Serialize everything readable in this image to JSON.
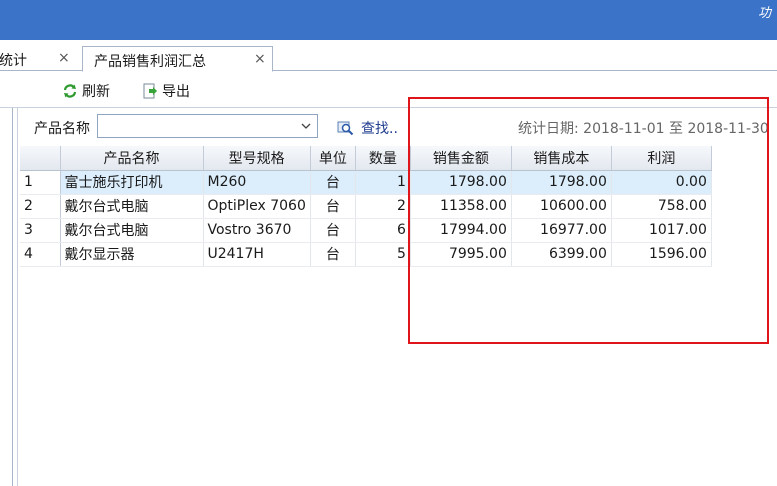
{
  "titlebar": {
    "corner_text": "功"
  },
  "tabs": [
    {
      "label": "统计",
      "active": false
    },
    {
      "label": "产品销售利润汇总",
      "active": true
    }
  ],
  "tab_close_glyph": "×",
  "toolbar": {
    "refresh_label": "刷新",
    "export_label": "导出"
  },
  "filter": {
    "product_label": "产品名称",
    "product_value": "",
    "find_label": "查找..",
    "date_label": "统计日期:",
    "date_from": "2018-11-01",
    "date_sep": "至",
    "date_to": "2018-11-30"
  },
  "table": {
    "columns": [
      "",
      "产品名称",
      "型号规格",
      "单位",
      "数量",
      "销售金额",
      "销售成本",
      "利润"
    ],
    "rows": [
      [
        "1",
        "富士施乐打印机",
        "M260",
        "台",
        "1",
        "1798.00",
        "1798.00",
        "0.00"
      ],
      [
        "2",
        "戴尔台式电脑",
        "OptiPlex 7060",
        "台",
        "2",
        "11358.00",
        "10600.00",
        "758.00"
      ],
      [
        "3",
        "戴尔台式电脑",
        "Vostro 3670",
        "台",
        "6",
        "17994.00",
        "16977.00",
        "1017.00"
      ],
      [
        "4",
        "戴尔显示器",
        "U2417H",
        "台",
        "5",
        "7995.00",
        "6399.00",
        "1596.00"
      ]
    ],
    "selected_row": 0
  },
  "colors": {
    "titlebar": "#3a73c8",
    "highlight": "#e0141b",
    "selected_row": "#dceefc"
  }
}
